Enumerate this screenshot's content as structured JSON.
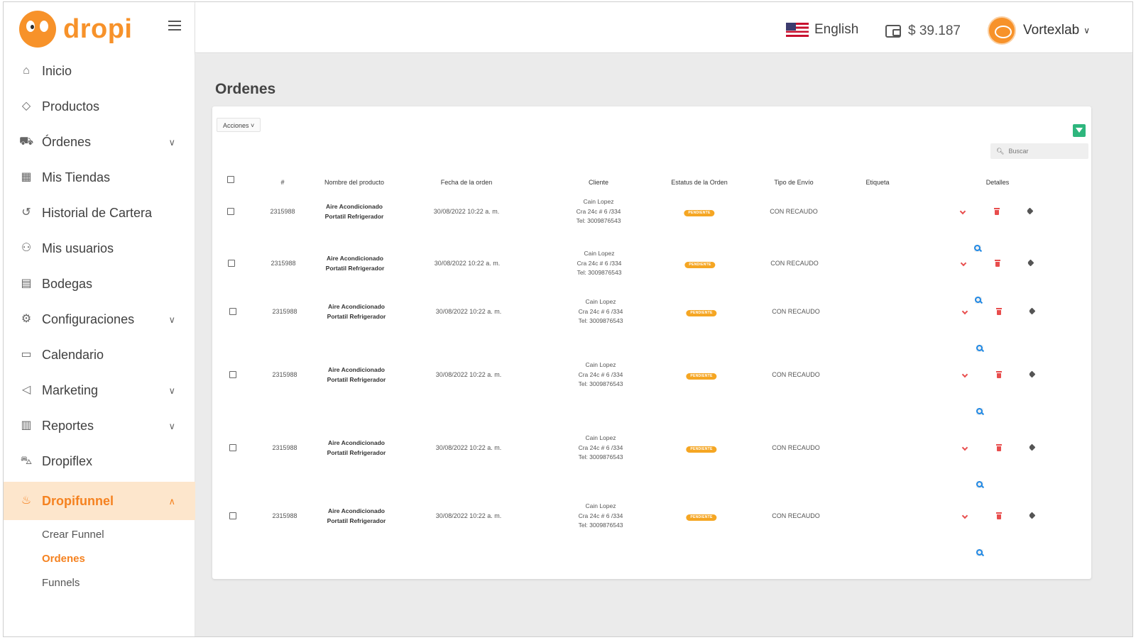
{
  "brand": {
    "name": "dropi"
  },
  "sidebar": {
    "items": [
      {
        "label": "Inicio",
        "icon": "home-icon",
        "glyph": "⌂",
        "has_chevron": false
      },
      {
        "label": "Productos",
        "icon": "tag-icon",
        "glyph": "◇",
        "has_chevron": false
      },
      {
        "label": "Órdenes",
        "icon": "cart-icon",
        "glyph": "⛟",
        "has_chevron": true
      },
      {
        "label": "Mis Tiendas",
        "icon": "store-icon",
        "glyph": "▦",
        "has_chevron": false
      },
      {
        "label": "Historial de Cartera",
        "icon": "history-icon",
        "glyph": "↺",
        "has_chevron": false
      },
      {
        "label": "Mis usuarios",
        "icon": "users-icon",
        "glyph": "⚇",
        "has_chevron": false
      },
      {
        "label": "Bodegas",
        "icon": "warehouse-icon",
        "glyph": "▤",
        "has_chevron": false
      },
      {
        "label": "Configuraciones",
        "icon": "gear-icon",
        "glyph": "⚙",
        "has_chevron": true
      },
      {
        "label": "Calendario",
        "icon": "calendar-icon",
        "glyph": "▭",
        "has_chevron": false
      },
      {
        "label": "Marketing",
        "icon": "megaphone-icon",
        "glyph": "◁",
        "has_chevron": true
      },
      {
        "label": "Reportes",
        "icon": "bar-chart-icon",
        "glyph": "▥",
        "has_chevron": true
      },
      {
        "label": "Dropiflex",
        "icon": "delivery-icon",
        "glyph": "⛍",
        "has_chevron": false
      },
      {
        "label": "Dropifunnel",
        "icon": "funnel-icon",
        "glyph": "♨",
        "has_chevron": true,
        "active": true
      }
    ],
    "subitems": [
      {
        "label": "Crear Funnel"
      },
      {
        "label": "Ordenes",
        "active": true
      },
      {
        "label": "Funnels"
      }
    ]
  },
  "topbar": {
    "language": "English",
    "balance": "$ 39.187",
    "user_name": "Vortexlab"
  },
  "page": {
    "title": "Ordenes",
    "actions_label": "Acciones ˅",
    "search_placeholder": "Buscar"
  },
  "table": {
    "headers": {
      "id": "#",
      "product": "Nombre del producto",
      "date": "Fecha de la orden",
      "client": "Cliente",
      "status": "Estatus de la Orden",
      "shipping": "Tipo de Envío",
      "label": "Etiqueta",
      "details": "Detalles"
    },
    "rows": [
      {
        "id": "2315988",
        "product_line1": "Aire Acondicionado",
        "product_line2": "Portatil Refrigerador",
        "date": "30/08/2022 10:22 a. m.",
        "client_name": "Cain Lopez",
        "client_address": "Cra 24c # 6 /334",
        "client_phone": "Tel: 3009876543",
        "status": "PENDIENTE",
        "shipping": "CON RECAUDO"
      },
      {
        "id": "2315988",
        "product_line1": "Aire Acondicionado",
        "product_line2": "Portatil Refrigerador",
        "date": "30/08/2022 10:22 a. m.",
        "client_name": "Cain Lopez",
        "client_address": "Cra 24c # 6 /334",
        "client_phone": "Tel: 3009876543",
        "status": "PENDIENTE",
        "shipping": "CON RECAUDO"
      },
      {
        "id": "2315988",
        "product_line1": "Aire Acondicionado",
        "product_line2": "Portatil Refrigerador",
        "date": "30/08/2022 10:22 a. m.",
        "client_name": "Cain Lopez",
        "client_address": "Cra 24c # 6 /334",
        "client_phone": "Tel: 3009876543",
        "status": "PENDIENTE",
        "shipping": "CON RECAUDO"
      },
      {
        "id": "2315988",
        "product_line1": "Aire Acondicionado",
        "product_line2": "Portatil Refrigerador",
        "date": "30/08/2022 10:22 a. m.",
        "client_name": "Cain Lopez",
        "client_address": "Cra 24c # 6 /334",
        "client_phone": "Tel: 3009876543",
        "status": "PENDIENTE",
        "shipping": "CON RECAUDO"
      },
      {
        "id": "2315988",
        "product_line1": "Aire Acondicionado",
        "product_line2": "Portatil Refrigerador",
        "date": "30/08/2022 10:22 a. m.",
        "client_name": "Cain Lopez",
        "client_address": "Cra 24c # 6 /334",
        "client_phone": "Tel: 3009876543",
        "status": "PENDIENTE",
        "shipping": "CON RECAUDO"
      },
      {
        "id": "2315988",
        "product_line1": "Aire Acondicionado",
        "product_line2": "Portatil Refrigerador",
        "date": "30/08/2022 10:22 a. m.",
        "client_name": "Cain Lopez",
        "client_address": "Cra 24c # 6 /334",
        "client_phone": "Tel: 3009876543",
        "status": "PENDIENTE",
        "shipping": "CON RECAUDO"
      }
    ],
    "row_action_icons": [
      "chevron-down-icon",
      "search-icon",
      "trash-icon",
      "assign-user-icon",
      "tag-icon"
    ]
  },
  "colors": {
    "brand": "#f7922a",
    "active_bg": "#fde6cc",
    "status_pending": "#f5a623",
    "filter_button": "#2eb67d",
    "danger": "#e84d4d",
    "info": "#1e88e5"
  }
}
